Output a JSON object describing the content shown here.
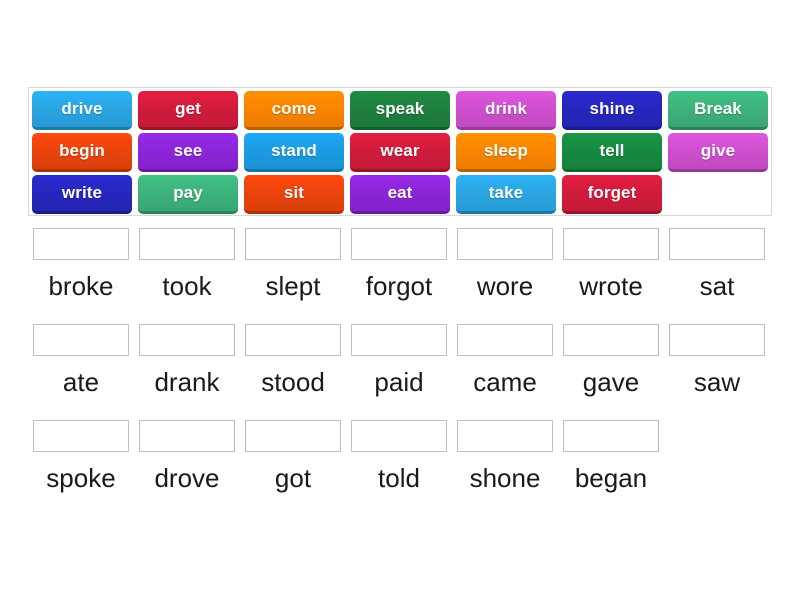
{
  "activity": {
    "type": "drag-and-drop-match",
    "tray": {
      "tiles": [
        {
          "label": "drive",
          "color": "#29a3e0"
        },
        {
          "label": "get",
          "color": "#cf1b3b"
        },
        {
          "label": "come",
          "color": "#f78400"
        },
        {
          "label": "speak",
          "color": "#1d7e3e"
        },
        {
          "label": "drink",
          "color": "#cc4ecc"
        },
        {
          "label": "shine",
          "color": "#2626bd"
        },
        {
          "label": "Break",
          "color": "#3cb07a"
        },
        {
          "label": "begin",
          "color": "#e8430c"
        },
        {
          "label": "see",
          "color": "#8a25d6"
        },
        {
          "label": "stand",
          "color": "#1b9ae0"
        },
        {
          "label": "wear",
          "color": "#cf1b3b"
        },
        {
          "label": "sleep",
          "color": "#f78400"
        },
        {
          "label": "tell",
          "color": "#16893f"
        },
        {
          "label": "give",
          "color": "#cc4ecc"
        },
        {
          "label": "write",
          "color": "#2626bd"
        },
        {
          "label": "pay",
          "color": "#3cb07a"
        },
        {
          "label": "sit",
          "color": "#e8430c"
        },
        {
          "label": "eat",
          "color": "#8a25d6"
        },
        {
          "label": "take",
          "color": "#29a3e0"
        },
        {
          "label": "forget",
          "color": "#cf1b3b"
        }
      ]
    },
    "answers": {
      "rows": [
        [
          "broke",
          "took",
          "slept",
          "forgot",
          "wore",
          "wrote",
          "sat"
        ],
        [
          "ate",
          "drank",
          "stood",
          "paid",
          "came",
          "gave",
          "saw"
        ],
        [
          "spoke",
          "drove",
          "got",
          "told",
          "shone",
          "began"
        ]
      ]
    },
    "colors": {
      "tray_border": "#d8d8d8",
      "drop_border": "#bfbfbf",
      "text": "#1a1a1a",
      "tile_text": "#ffffff",
      "background": "#ffffff"
    }
  }
}
